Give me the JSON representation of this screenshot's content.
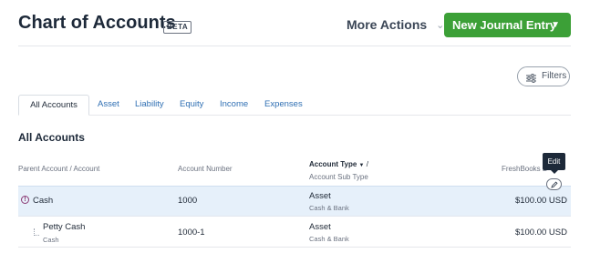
{
  "header": {
    "title": "Chart of Accounts",
    "badge": "BETA",
    "more_actions_label": "More Actions",
    "new_journal_label": "New Journal Entry"
  },
  "filters": {
    "label": "Filters"
  },
  "tabs": [
    {
      "label": "All Accounts",
      "active": true
    },
    {
      "label": "Asset"
    },
    {
      "label": "Liability"
    },
    {
      "label": "Equity"
    },
    {
      "label": "Income"
    },
    {
      "label": "Expenses"
    }
  ],
  "section_title": "All Accounts",
  "columns": {
    "parent_account": "Parent Account / Account",
    "account_number": "Account Number",
    "account_type": "Account Type",
    "account_type_slash": "/",
    "account_sub_type": "Account Sub Type",
    "balance": "FreshBooks B"
  },
  "tooltip": {
    "label": "Edit"
  },
  "rows": [
    {
      "name": "Cash",
      "number": "1000",
      "type": "Asset",
      "sub_type": "Cash & Bank",
      "balance": "$100.00 USD"
    },
    {
      "name": "Petty Cash",
      "parent": "Cash",
      "number": "1000-1",
      "type": "Asset",
      "sub_type": "Cash & Bank",
      "balance": "$100.00 USD"
    }
  ],
  "colors": {
    "primary_green": "#3ca037",
    "link_blue": "#2f6fb3",
    "highlight_row": "#e6f0fa",
    "warning": "#8b3a74"
  }
}
